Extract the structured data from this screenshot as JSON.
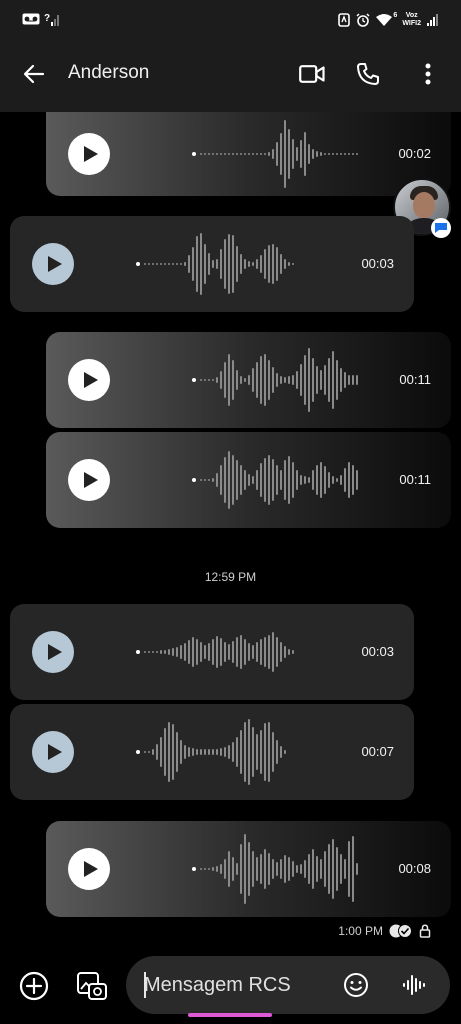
{
  "status_bar": {
    "left_icons": [
      "voicemail-icon",
      "no-signal-icon"
    ],
    "right_icons": [
      "nfc-icon",
      "alarm-icon",
      "wifi-icon",
      "volte-wifi-icon",
      "signal-icon"
    ],
    "wifi_label": "6",
    "volte_label_top": "Voz",
    "volte_label_bottom": "WIFI2"
  },
  "header": {
    "contact_name": "Anderson",
    "back_icon": "arrow-back-icon",
    "video_icon": "videocam-icon",
    "call_icon": "phone-icon",
    "menu_icon": "more-vert-icon"
  },
  "messages": [
    {
      "direction": "out",
      "duration": "00:02"
    },
    {
      "direction": "in",
      "duration": "00:03"
    },
    {
      "direction": "out",
      "duration": "00:11"
    },
    {
      "direction": "out",
      "duration": "00:11"
    },
    {
      "direction": "in",
      "duration": "00:03"
    },
    {
      "direction": "in",
      "duration": "00:07"
    },
    {
      "direction": "out",
      "duration": "00:08"
    }
  ],
  "timestamp_divider": "12:59 PM",
  "sent_meta": {
    "time": "1:00 PM",
    "status_icon": "read-receipt-icon",
    "lock_icon": "lock-icon"
  },
  "composer": {
    "placeholder": "Mensagem RCS",
    "value": "",
    "add_icon": "add-circle-icon",
    "gallery_icon": "gallery-icon",
    "emoji_icon": "emoji-icon",
    "voice_icon": "voice-waveform-icon"
  },
  "colors": {
    "background": "#000000",
    "bar_background": "#1c1c1c",
    "incoming_bubble": "#262626",
    "incoming_play": "#b6c8d6",
    "rcs_badge": "#1a73e8",
    "home_indicator": "#e05ad8"
  }
}
